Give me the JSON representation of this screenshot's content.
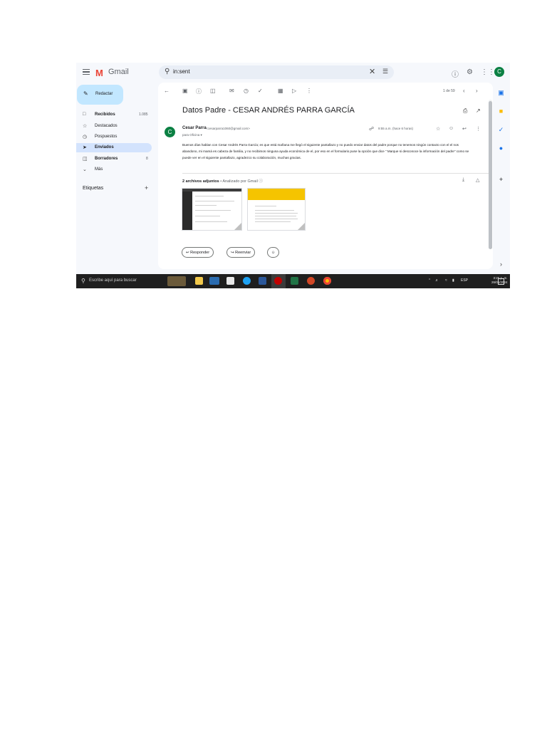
{
  "app": {
    "logo_m": "M",
    "logo_text": "Gmail"
  },
  "search": {
    "icon": "search-icon",
    "value": "in:sent",
    "clear_icon": "close-icon",
    "filter_icon": "tune-icon"
  },
  "topbar": {
    "help_icon": "help-icon",
    "settings_icon": "gear-icon",
    "apps_icon": "apps-grid-icon",
    "avatar_letter": "C"
  },
  "sidebar": {
    "compose_label": "Redactar",
    "items": [
      {
        "label": "Recibidos",
        "count": "1.085",
        "icon": "inbox-icon"
      },
      {
        "label": "Destacados",
        "count": "",
        "icon": "star-icon"
      },
      {
        "label": "Pospuestos",
        "count": "",
        "icon": "clock-icon"
      },
      {
        "label": "Enviados",
        "count": "",
        "icon": "send-icon"
      },
      {
        "label": "Borradores",
        "count": "8",
        "icon": "draft-icon"
      },
      {
        "label": "Más",
        "count": "",
        "icon": "chevron-down-icon"
      }
    ],
    "labels_heading": "Etiquetas",
    "labels_add": "+"
  },
  "toolbar": {
    "pager": "1 de 59"
  },
  "message": {
    "subject": "Datos Padre - CESAR ANDRÉS PARRA GARCÍA",
    "avatar_letter": "C",
    "sender_name": "Cesar Parra",
    "sender_email": "<cesarparra1060@gmail.com>",
    "to": "para Oficina ▾",
    "time": "9:55 a.m. (hace 6 horas)",
    "body": "Buenos días hablan con Cesar Andrés Parra García; es que está mañana me llegó el siguiente pantallazo y no puedo enviar datos del padre porque no tenemos ningún contacto con el el nos abandono, mi mamá es cabeza de familia, y no recibimos ninguna ayuda económica de el, por eso en el formulario puse la opción que dice \" Marque si desconoce la información del padre\" como se puede ver en el siguiente pantallazo, agradezco su colaboración, muchas gracias."
  },
  "attachments": {
    "title": "2 archivos adjuntos",
    "subtitle": "• Analizado por Gmail ⓘ"
  },
  "actions": {
    "reply_label": "Responder",
    "forward_label": "Reenviar"
  },
  "taskbar": {
    "search_placeholder": "Escribe aquí para buscar",
    "lang": "ESP",
    "time": "3:25 p. m.",
    "date": "26/01/2024"
  },
  "colors": {
    "accent": "#0b57d0",
    "compose_bg": "#c2e7ff",
    "active_nav": "#d3e3fd",
    "avatar": "#0b8043",
    "gmail_red": "#ea4335"
  }
}
